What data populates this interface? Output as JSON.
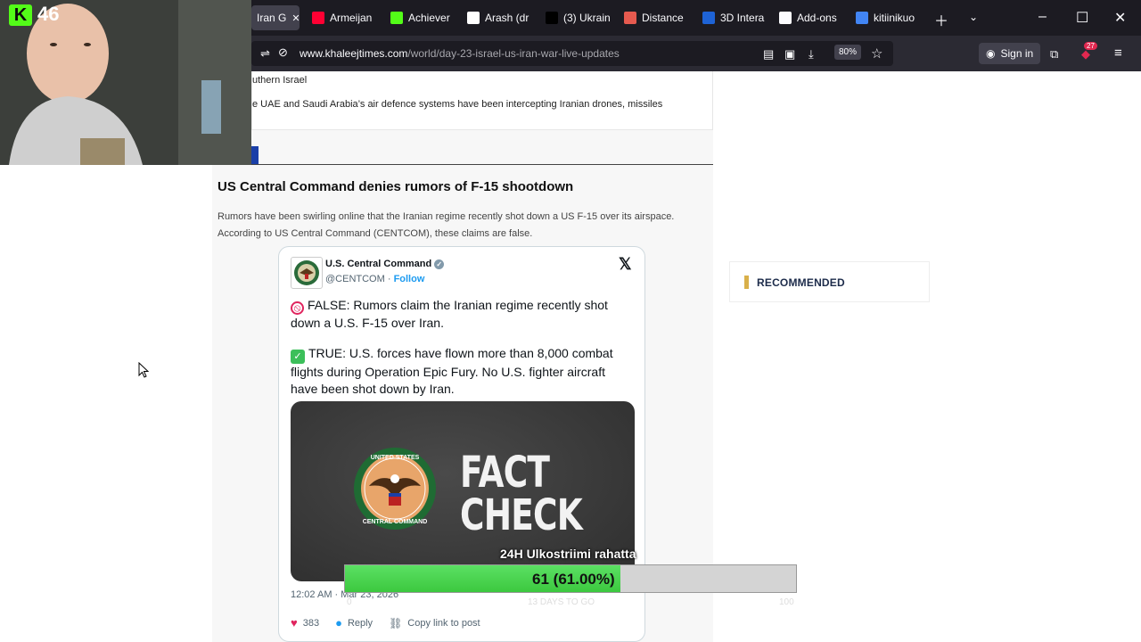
{
  "browser": {
    "tabs": [
      {
        "label": "Iran G",
        "active": true,
        "favicon_color": "#42414d",
        "icon": "globe-icon"
      },
      {
        "label": "Armeijan",
        "favicon_color": "#ff0033",
        "icon": "youtube-icon"
      },
      {
        "label": "Achiever",
        "favicon_color": "#53fc18",
        "icon": "kick-icon"
      },
      {
        "label": "Arash (dr",
        "favicon_color": "#ffffff",
        "icon": "wikipedia-icon"
      },
      {
        "label": "(3) Ukrain",
        "favicon_color": "#000000",
        "icon": "x-icon"
      },
      {
        "label": "Distance",
        "favicon_color": "#e65a4f",
        "icon": "app-icon"
      },
      {
        "label": "3D Intera",
        "favicon_color": "#1e63d6",
        "icon": "globe-icon"
      },
      {
        "label": "Add-ons",
        "favicon_color": "#fbfbfe",
        "icon": "puzzle-icon"
      },
      {
        "label": "kitiinikuo",
        "favicon_color": "#4285f4",
        "icon": "google-icon"
      }
    ],
    "url_domain": "www.khaleejtimes.com",
    "url_path": "/world/day-23-israel-us-iran-war-live-updates",
    "zoom": "80%",
    "sign_in": "Sign in",
    "extension_badge": "27"
  },
  "page": {
    "prev_snippet_1": "uthern Israel",
    "prev_snippet_2": "e UAE and Saudi Arabia’s air defence systems have been intercepting Iranian drones, missiles",
    "headline": "US Central Command denies rumors of F-15 shootdown",
    "lead": "Rumors have been swirling online that the Iranian regime recently shot down a US F-15 over its airspace. According to US Central Command (CENTCOM), these claims are false.",
    "recommended": "RECOMMENDED"
  },
  "tweet": {
    "author": "U.S. Central Command",
    "handle": "@CENTCOM",
    "follow": "Follow",
    "text_false": "FALSE: Rumors claim the Iranian regime recently shot down a U.S. F-15 over Iran.",
    "text_true": "TRUE: U.S. forces have flown more than 8,000 combat flights during Operation Epic Fury. No U.S. fighter aircraft have been shot down by Iran.",
    "image_line1": "FACT",
    "image_line2": "CHECK",
    "seal_text": "UNITED STATES CENTRAL COMMAND",
    "time": "12:02 AM · Mar 23, 2026",
    "likes": "383",
    "reply": "Reply",
    "copy_link": "Copy link to post"
  },
  "stream": {
    "viewer_count": "46",
    "goal_title": "24H Ulkostriimi rahatta",
    "goal_value": "61 (61.00%)",
    "goal_fraction": 0.61,
    "goal_min": "0",
    "goal_days": "13 DAYS TO GO",
    "goal_max": "100"
  }
}
